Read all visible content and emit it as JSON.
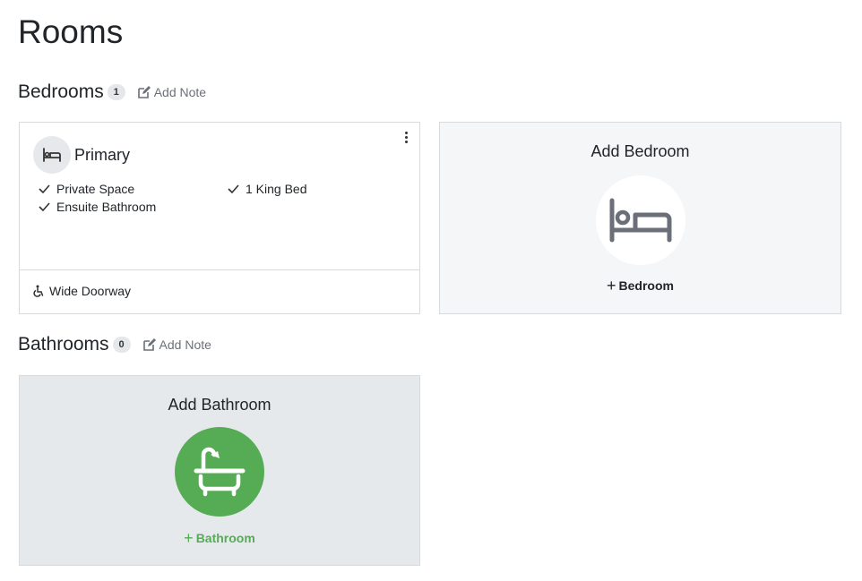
{
  "page": {
    "title": "Rooms"
  },
  "bedrooms": {
    "title": "Bedrooms",
    "count": "1",
    "add_note_label": "Add Note",
    "rooms": [
      {
        "name": "Primary",
        "features": [
          "Private Space",
          "Ensuite Bathroom",
          "1 King Bed"
        ],
        "accessibility": "Wide Doorway"
      }
    ],
    "add_card": {
      "title": "Add Bedroom",
      "action_label": "Bedroom",
      "action_prefix": "+"
    }
  },
  "bathrooms": {
    "title": "Bathrooms",
    "count": "0",
    "add_note_label": "Add Note",
    "add_card": {
      "title": "Add Bathroom",
      "action_label": "Bathroom",
      "action_prefix": "+"
    }
  },
  "icons": {
    "edit": "edit-note-icon",
    "bed": "bed-icon",
    "bath": "bathtub-icon",
    "check": "check-icon",
    "accessibility": "wheelchair-icon",
    "more": "kebab-menu-icon"
  },
  "colors": {
    "add_bathroom_accent": "#55ac55",
    "icon_gray": "#6b7078",
    "bedroom_card_bg": "#f5f6f8",
    "bathroom_card_bg": "#e6e9ec"
  }
}
